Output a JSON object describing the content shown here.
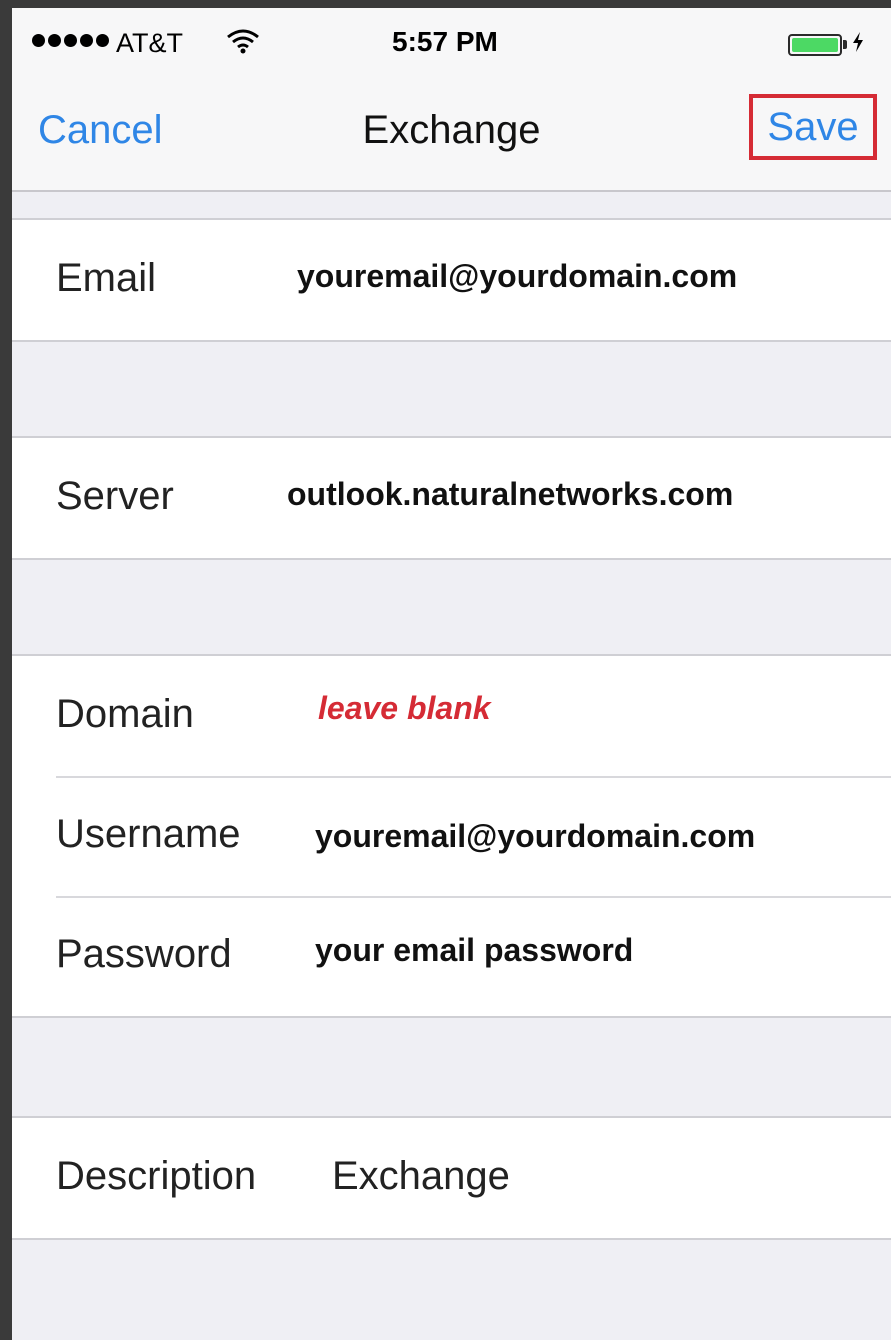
{
  "status_bar": {
    "carrier": "AT&T",
    "time": "5:57 PM",
    "battery_level": 1.0,
    "battery_color": "#4cd964"
  },
  "nav": {
    "cancel_label": "Cancel",
    "title": "Exchange",
    "save_label": "Save"
  },
  "fields": {
    "email": {
      "label": "Email",
      "value": "youremail@yourdomain.com"
    },
    "server": {
      "label": "Server",
      "value": "outlook.naturalnetworks.com"
    },
    "domain": {
      "label": "Domain",
      "value": "leave blank"
    },
    "username": {
      "label": "Username",
      "value": "youremail@yourdomain.com"
    },
    "password": {
      "label": "Password",
      "value": "your email password"
    },
    "description": {
      "label": "Description",
      "value": "Exchange"
    }
  },
  "colors": {
    "accent": "#2f86e6",
    "highlight": "#d52b35",
    "group_background": "#efeff4"
  },
  "icons": [
    "signal-dots-icon",
    "wifi-icon",
    "battery-icon",
    "charging-bolt-icon"
  ]
}
